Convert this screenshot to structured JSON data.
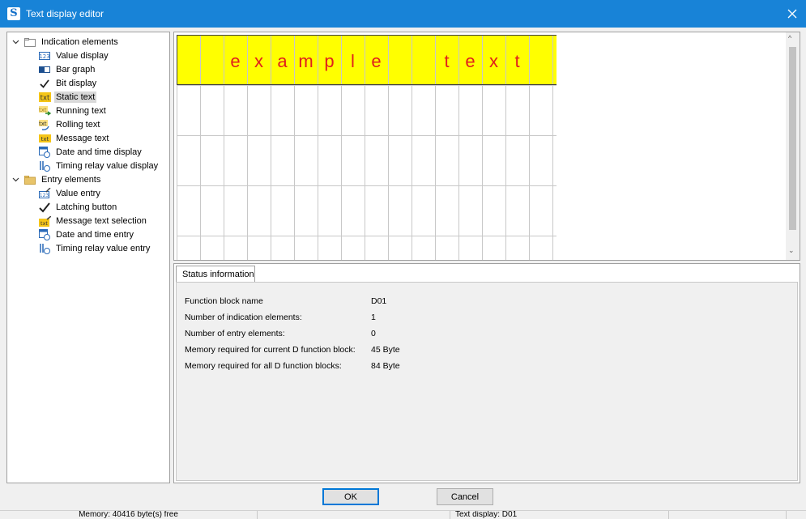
{
  "window": {
    "title": "Text display editor",
    "app_icon_glyph": "S",
    "close_glyph": "×",
    "titlebar_color": "#1883d7"
  },
  "tree": {
    "groups": [
      {
        "label": "Indication elements",
        "icon": "folder-open-icon",
        "items": [
          {
            "label": "Value display",
            "icon": "value-display-icon"
          },
          {
            "label": "Bar graph",
            "icon": "bar-graph-icon"
          },
          {
            "label": "Bit display",
            "icon": "checkmark-icon"
          },
          {
            "label": "Static text",
            "icon": "static-text-icon",
            "selected": true
          },
          {
            "label": "Running text",
            "icon": "running-text-icon"
          },
          {
            "label": "Rolling text",
            "icon": "rolling-text-icon"
          },
          {
            "label": "Message text",
            "icon": "message-text-icon"
          },
          {
            "label": "Date and time display",
            "icon": "date-time-icon"
          },
          {
            "label": "Timing relay value display",
            "icon": "timing-relay-icon"
          }
        ]
      },
      {
        "label": "Entry elements",
        "icon": "folder-icon",
        "items": [
          {
            "label": "Value entry",
            "icon": "value-entry-icon"
          },
          {
            "label": "Latching button",
            "icon": "latching-button-icon"
          },
          {
            "label": "Message text selection",
            "icon": "message-selection-icon"
          },
          {
            "label": "Date and time entry",
            "icon": "date-time-entry-icon"
          },
          {
            "label": "Timing relay value entry",
            "icon": "timing-relay-entry-icon"
          }
        ]
      }
    ]
  },
  "editor": {
    "text_cells": [
      "",
      "",
      "e",
      "x",
      "a",
      "m",
      "p",
      "l",
      "e",
      "",
      "",
      "t",
      "e",
      "x",
      "t",
      "",
      ""
    ],
    "highlight_color": "#ffff00",
    "text_color": "#e0201c",
    "scroll_up_glyph": "^",
    "scroll_down_glyph": "⌄"
  },
  "status": {
    "tab_label": "Status information",
    "rows": [
      {
        "label": "Function block name",
        "value": "D01"
      },
      {
        "label": "Number of indication elements:",
        "value": "1"
      },
      {
        "label": "Number of entry elements:",
        "value": "0"
      },
      {
        "label": "Memory required for current D function block:",
        "value": "45 Byte"
      },
      {
        "label": "Memory required for all D function blocks:",
        "value": "84 Byte"
      }
    ]
  },
  "buttons": {
    "ok": "OK",
    "cancel": "Cancel"
  },
  "statusbar": {
    "memory": "Memory: 40416 byte(s) free",
    "display": "Text display: D01"
  }
}
